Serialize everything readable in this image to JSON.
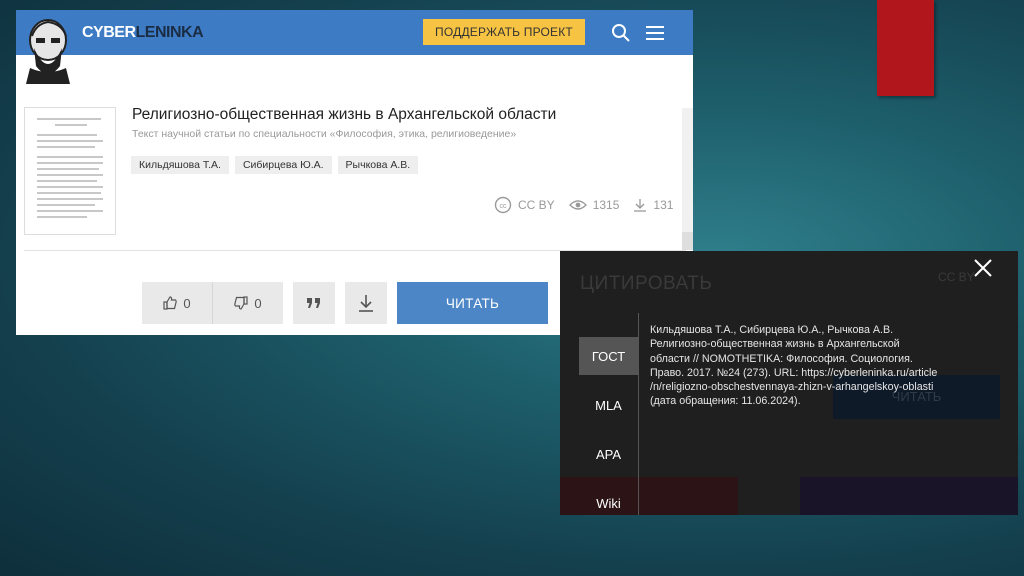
{
  "site": {
    "logo": {
      "part1": "CYBER",
      "part2": "LENINKA"
    },
    "support_button": "ПОДДЕРЖАТЬ ПРОЕКТ",
    "icons": {
      "search": "search-icon",
      "menu": "hamburger-menu-icon"
    }
  },
  "article": {
    "title": "Религиозно-общественная жизнь в Архангельской области",
    "subtitle": "Текст научной статьи по специальности «Философия, этика, религиоведение»",
    "authors": [
      "Кильдяшова Т.А.",
      "Сибирцева Ю.А.",
      "Рычкова А.В."
    ],
    "license": "CC BY",
    "views": "1315",
    "downloads": "131"
  },
  "actions": {
    "likes": "0",
    "dislikes": "0",
    "read_button": "ЧИТАТЬ"
  },
  "cite_dialog": {
    "ghost_title": "ЦИТИРОВАТЬ",
    "ghost_right": "CC BY",
    "ghost_button": "ЧИТАТЬ",
    "tabs": [
      "ГОСТ",
      "MLA",
      "APA",
      "Wiki"
    ],
    "active_tab": "ГОСТ",
    "citation_lines": [
      "Кильдяшова Т.А., Сибирцева Ю.А., Рычкова А.В.",
      "Религиозно-общественная жизнь в Архангельской",
      "области // NOMOTHETIKA: Философия. Социология.",
      "Право. 2017. №24 (273). URL: https://cyberleninka.ru/article",
      "/n/religiozno-obschestvennaya-zhizn-v-arhangelskoy-oblasti",
      "(дата обращения: 11.06.2024)."
    ]
  },
  "colors": {
    "header_blue": "#3d7cc4",
    "support_yellow": "#f6c343",
    "read_blue": "#4d86c6",
    "accent_red": "#b0161b",
    "dialog_bg": "#1f1f1f"
  }
}
